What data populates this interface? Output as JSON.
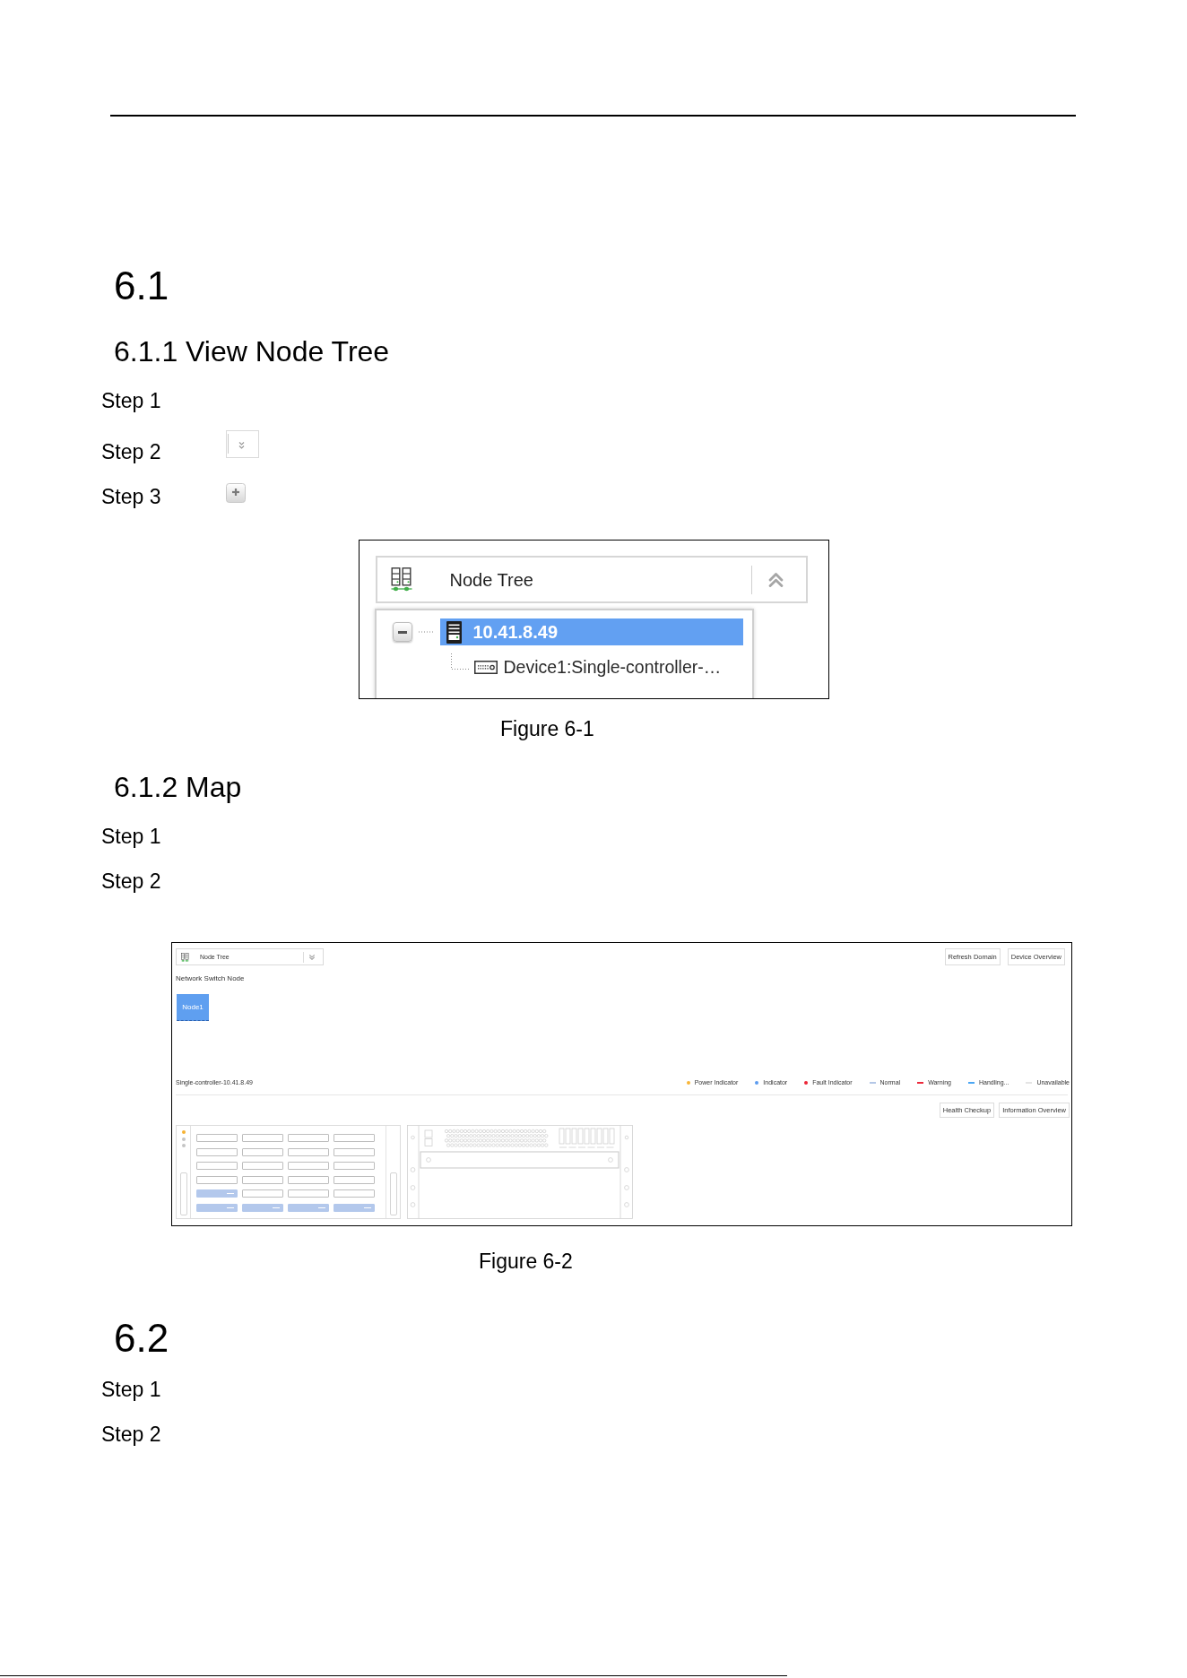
{
  "sections": [
    {
      "heading": "6.1",
      "subsections": [
        {
          "heading": "6.1.1 View Node Tree",
          "steps": [
            {
              "label": "Step 1",
              "kind": "plain"
            },
            {
              "label": "Step 2",
              "kind": "toggle"
            },
            {
              "label": "Step 3",
              "kind": "expander"
            }
          ],
          "figure": {
            "kind": "node_tree",
            "header": {
              "title": "Node Tree",
              "expanded": true
            },
            "tree": [
              {
                "label": "10.41.8.49",
                "selected": true,
                "expanded": true,
                "children": [
                  {
                    "label": "Device1:Single-controller-…",
                    "selected": false
                  }
                ]
              }
            ]
          },
          "caption": "Figure 6-1"
        },
        {
          "heading": "6.1.2 Map",
          "steps": [
            {
              "label": "Step 1"
            },
            {
              "label": "Step 2"
            }
          ],
          "figure": {
            "kind": "map",
            "node_tree": {
              "title": "Node Tree",
              "expanded": false
            },
            "top_buttons": [
              {
                "label": "Refresh Domain"
              },
              {
                "label": "Device Overview"
              }
            ],
            "group_title": "Network Switch Node",
            "nodes": [
              {
                "label": "Node1"
              }
            ],
            "device_title": "Single-controller-10.41.8.49",
            "legend": [
              {
                "kind": "dot",
                "label": "Power Indicator",
                "color": "#f8b537"
              },
              {
                "kind": "dot",
                "label": "Indicator",
                "color": "#5b9bef"
              },
              {
                "kind": "dot",
                "label": "Fault Indicator",
                "color": "#ec2436"
              },
              {
                "kind": "dash",
                "label": "Normal",
                "color": "#b4c7e7"
              },
              {
                "kind": "dash",
                "label": "Warning",
                "color": "#ec2a3c"
              },
              {
                "kind": "dash",
                "label": "Handling...",
                "color": "#4ba6f3"
              },
              {
                "kind": "dash",
                "label": "Unavailable",
                "color": "#e4e4e4"
              }
            ],
            "device_buttons": [
              {
                "label": "Health Checkup"
              },
              {
                "label": "Information Overview"
              }
            ],
            "front_panel": {
              "leds": [
                {
                  "color": "#f6b232"
                },
                {
                  "color": "#c4c4c4"
                },
                {
                  "color": "#c4c4c4"
                }
              ],
              "bay_rows": [
                {
                  "bays": [
                    {
                      "occupied": false
                    },
                    {
                      "occupied": false
                    },
                    {
                      "occupied": false
                    },
                    {
                      "occupied": false
                    }
                  ]
                },
                {
                  "bays": [
                    {
                      "occupied": false
                    },
                    {
                      "occupied": false
                    },
                    {
                      "occupied": false
                    },
                    {
                      "occupied": false
                    }
                  ]
                },
                {
                  "bays": [
                    {
                      "occupied": false
                    },
                    {
                      "occupied": false
                    },
                    {
                      "occupied": false
                    },
                    {
                      "occupied": false
                    }
                  ]
                },
                {
                  "bays": [
                    {
                      "occupied": false
                    },
                    {
                      "occupied": false
                    },
                    {
                      "occupied": false
                    },
                    {
                      "occupied": false
                    }
                  ]
                },
                {
                  "bays": [
                    {
                      "occupied": true
                    },
                    {
                      "occupied": false
                    },
                    {
                      "occupied": false
                    },
                    {
                      "occupied": false
                    }
                  ]
                },
                {
                  "bays": [
                    {
                      "occupied": true
                    },
                    {
                      "occupied": true
                    },
                    {
                      "occupied": true
                    },
                    {
                      "occupied": true
                    }
                  ]
                }
              ]
            }
          },
          "caption": "Figure 6-2"
        }
      ]
    },
    {
      "heading": "6.2",
      "steps": [
        {
          "label": "Step 1"
        },
        {
          "label": "Step 2"
        }
      ]
    }
  ]
}
